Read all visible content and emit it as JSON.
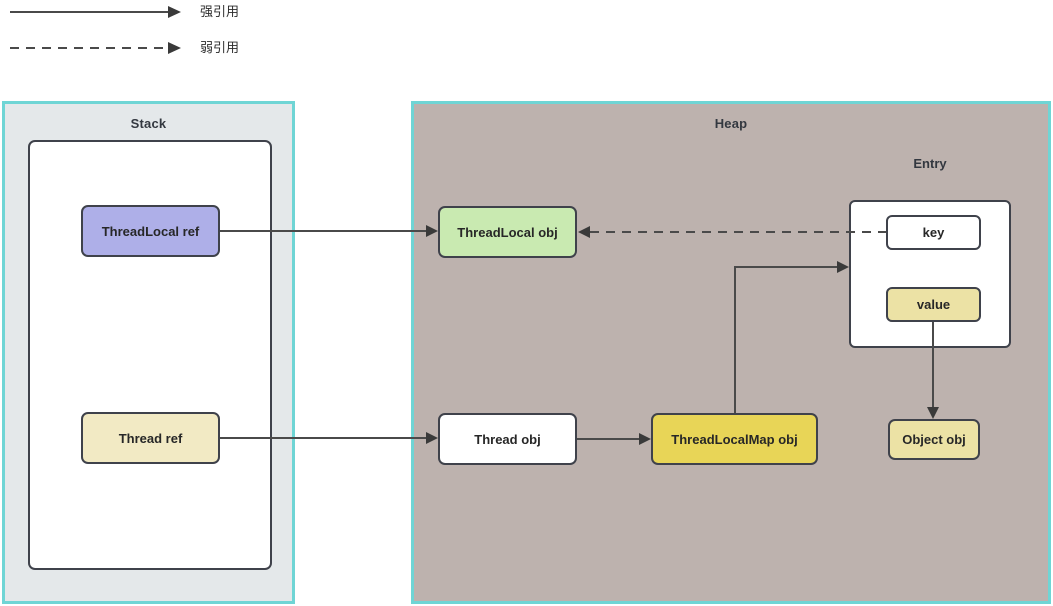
{
  "legend": {
    "items": [
      {
        "label": "强引用",
        "style": "solid",
        "icon": "solid-arrow-icon"
      },
      {
        "label": "弱引用",
        "style": "dashed",
        "icon": "dashed-arrow-icon"
      }
    ]
  },
  "regions": {
    "stack": {
      "title": "Stack",
      "fill": "#e4e8ea",
      "border": "#6fd5d5"
    },
    "heap": {
      "title": "Heap",
      "fill": "#bdb2ae",
      "border": "#6fd5d5"
    },
    "entry": {
      "title": "Entry",
      "fill": "#ffffff",
      "border": "#3f424b"
    }
  },
  "nodes": {
    "threadlocal_ref": {
      "label": "ThreadLocal ref",
      "fill": "#aeafe8"
    },
    "thread_ref": {
      "label": "Thread ref",
      "fill": "#f2eac4"
    },
    "threadlocal_obj": {
      "label": "ThreadLocal obj",
      "fill": "#c9eab1"
    },
    "thread_obj": {
      "label": "Thread obj",
      "fill": "#ffffff"
    },
    "threadlocalmap_obj": {
      "label": "ThreadLocalMap obj",
      "fill": "#e8d557"
    },
    "key": {
      "label": "key",
      "fill": "#ffffff"
    },
    "value": {
      "label": "value",
      "fill": "#ece2a5"
    },
    "object_obj": {
      "label": "Object obj",
      "fill": "#ece2a5"
    }
  },
  "edges": [
    {
      "from": "threadlocal_ref",
      "to": "threadlocal_obj",
      "type": "strong"
    },
    {
      "from": "key",
      "to": "threadlocal_obj",
      "type": "weak"
    },
    {
      "from": "thread_ref",
      "to": "thread_obj",
      "type": "strong"
    },
    {
      "from": "thread_obj",
      "to": "threadlocalmap_obj",
      "type": "strong"
    },
    {
      "from": "threadlocalmap_obj",
      "to": "entry",
      "type": "strong"
    },
    {
      "from": "value",
      "to": "object_obj",
      "type": "strong"
    }
  ]
}
